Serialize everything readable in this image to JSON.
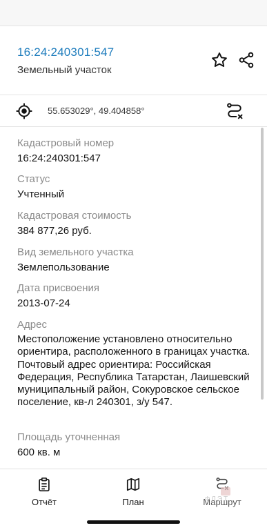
{
  "header": {
    "cadastral_number": "16:24:240301:547",
    "object_type": "Земельный участок",
    "actions": {
      "favorite_icon": "star-icon",
      "share_icon": "share-icon"
    }
  },
  "location": {
    "coordinates": "55.653029°, 49.404858°",
    "locate_icon": "crosshair-icon",
    "route_icon": "route-icon"
  },
  "details": [
    {
      "label": "Кадастровый номер",
      "value": "16:24:240301:547"
    },
    {
      "label": "Статус",
      "value": "Учтенный"
    },
    {
      "label": "Кадастровая стоимость",
      "value": "384 877,26 руб."
    },
    {
      "label": "Вид земельного участка",
      "value": "Землепользование"
    },
    {
      "label": "Дата присвоения",
      "value": "2013-07-24"
    },
    {
      "label": "Адрес",
      "value": "Местоположение установлено относительно ориентира, расположенного в границах участка. Почтовый адрес ориентира: Российская Федерация, Республика Татарстан, Лаишевский муниципальный район, Сокуровское сельское поселение, кв-л 240301, з/у 547."
    },
    {
      "label": "Площадь уточненная",
      "value": "600 кв. м"
    }
  ],
  "bottom_nav": {
    "tabs": [
      {
        "label": "Отчёт",
        "icon": "clipboard-icon"
      },
      {
        "label": "План",
        "icon": "map-icon"
      },
      {
        "label": "Маршрут",
        "icon": "route-icon"
      }
    ]
  },
  "watermark": "ФЛЭТ",
  "colors": {
    "accent": "#1f7dbd",
    "label_gray": "#8a8a8a",
    "text": "#151515"
  }
}
